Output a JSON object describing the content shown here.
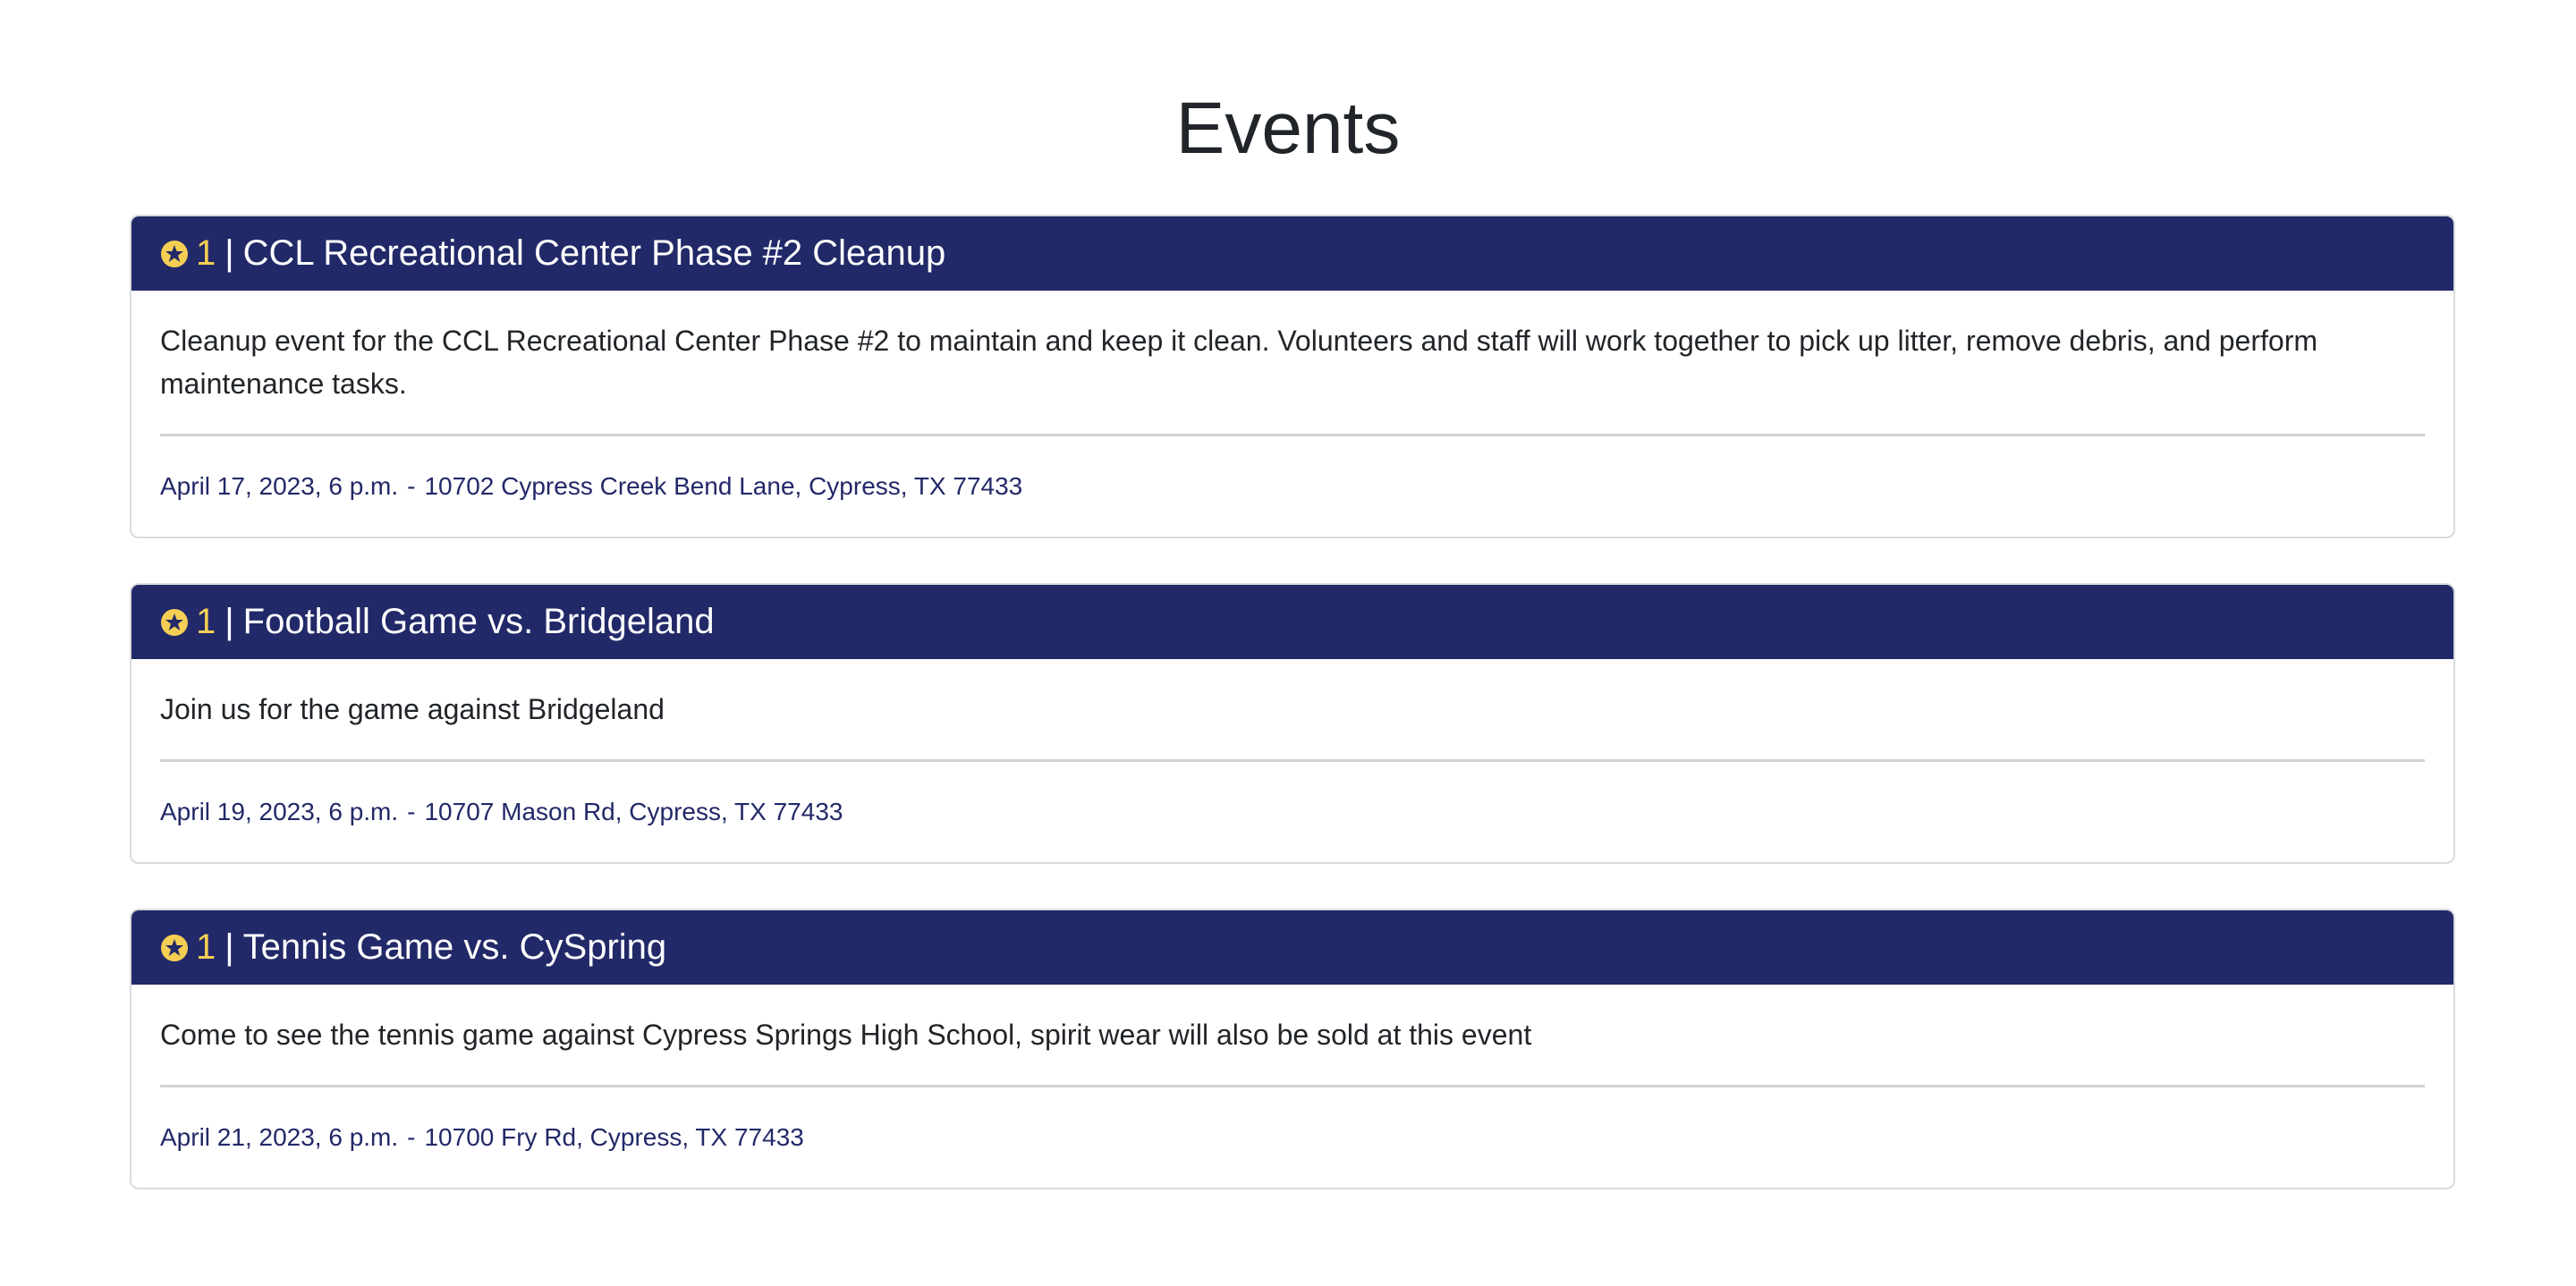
{
  "page": {
    "title": "Events"
  },
  "colors": {
    "header_bg": "#222968",
    "points": "#f4cf54",
    "meta_text": "#222968"
  },
  "events": [
    {
      "icon": "star-circle-icon",
      "points": "1",
      "separator": "|",
      "title": "CCL Recreational Center Phase #2 Cleanup",
      "description": "Cleanup event for the CCL Recreational Center Phase #2 to maintain and keep it clean. Volunteers and staff will work together to pick up litter, remove debris, and perform maintenance tasks.",
      "date": "April 17, 2023, 6 p.m.",
      "meta_separator": "-",
      "location": "10702 Cypress Creek Bend Lane, Cypress, TX 77433"
    },
    {
      "icon": "star-circle-icon",
      "points": "1",
      "separator": "|",
      "title": "Football Game vs. Bridgeland",
      "description": "Join us for the game against Bridgeland",
      "date": "April 19, 2023, 6 p.m.",
      "meta_separator": "-",
      "location": "10707 Mason Rd, Cypress, TX 77433"
    },
    {
      "icon": "star-circle-icon",
      "points": "1",
      "separator": "|",
      "title": "Tennis Game vs. CySpring",
      "description": "Come to see the tennis game against Cypress Springs High School, spirit wear will also be sold at this event",
      "date": "April 21, 2023, 6 p.m.",
      "meta_separator": "-",
      "location": "10700 Fry Rd, Cypress, TX 77433"
    }
  ]
}
